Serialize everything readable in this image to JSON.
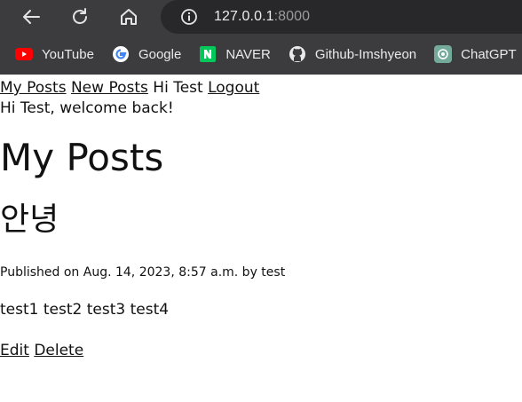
{
  "browser": {
    "url_host": "127.0.0.1",
    "url_port": ":8000",
    "bookmarks": [
      {
        "label": "YouTube",
        "icon": "youtube-icon"
      },
      {
        "label": "Google",
        "icon": "google-icon"
      },
      {
        "label": "NAVER",
        "icon": "naver-icon"
      },
      {
        "label": "Github-Imshyeon",
        "icon": "github-icon"
      },
      {
        "label": "ChatGPT",
        "icon": "chatgpt-icon"
      }
    ]
  },
  "nav": {
    "my_posts": "My Posts",
    "new_posts": "New Posts",
    "greeting": "Hi Test",
    "logout": "Logout"
  },
  "welcome": "Hi Test, welcome back!",
  "page_title": "My Posts",
  "post": {
    "title": "안녕",
    "meta": "Published on Aug. 14, 2023, 8:57 a.m. by test",
    "body": "test1 test2 test3 test4",
    "edit": "Edit",
    "delete": "Delete"
  }
}
